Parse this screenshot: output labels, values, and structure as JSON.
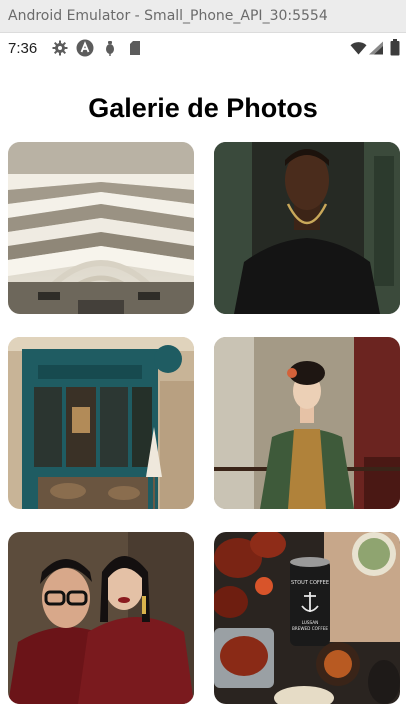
{
  "window": {
    "title": "Android Emulator - Small_Phone_API_30:5554"
  },
  "statusbar": {
    "time": "7:36",
    "left_icons": [
      "gear-icon",
      "a-badge-icon",
      "usb-debug-icon",
      "sd-card-icon"
    ],
    "right_icons": [
      "wifi-icon",
      "cell-signal-icon",
      "battery-icon"
    ]
  },
  "app": {
    "title": "Galerie de Photos"
  },
  "gallery": {
    "photos": [
      {
        "subject": "architecture-ceiling-photo"
      },
      {
        "subject": "man-black-tshirt-portrait"
      },
      {
        "subject": "teal-cafe-storefront"
      },
      {
        "subject": "woman-traditional-dress"
      },
      {
        "subject": "couple-fashion-portrait"
      },
      {
        "subject": "food-spread-with-can",
        "can_label_lines": [
          "STOUT COFFEE",
          "LUSSAN",
          "BREWED COFFEE"
        ]
      }
    ]
  },
  "colors": {
    "background": "#ffffff",
    "titlebar": "#ececec",
    "heading": "#000000"
  }
}
